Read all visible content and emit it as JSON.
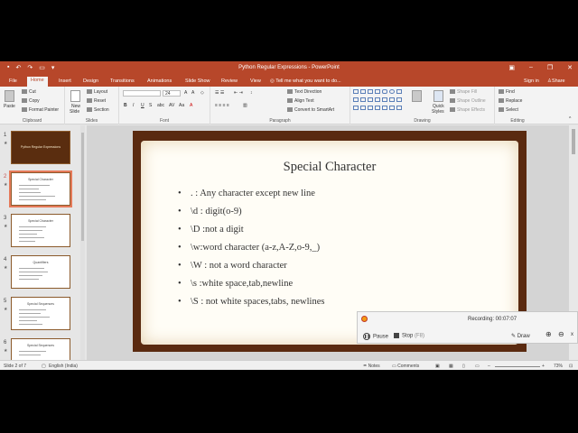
{
  "window": {
    "title": "Python Regular Expressions - PowerPoint"
  },
  "tabs": [
    {
      "label": "File"
    },
    {
      "label": "Home"
    },
    {
      "label": "Insert"
    },
    {
      "label": "Design"
    },
    {
      "label": "Transitions"
    },
    {
      "label": "Animations"
    },
    {
      "label": "Slide Show"
    },
    {
      "label": "Review"
    },
    {
      "label": "View"
    }
  ],
  "tell_me": "Tell me what you want to do...",
  "sign_in": "Sign in",
  "share": "Share",
  "ribbon": {
    "clipboard": {
      "label": "Clipboard",
      "paste": "Paste",
      "cut": "Cut",
      "copy": "Copy",
      "format_painter": "Format Painter"
    },
    "slides": {
      "label": "Slides",
      "new_slide": "New",
      "new_slide_2": "Slide",
      "layout": "Layout",
      "reset": "Reset",
      "section": "Section"
    },
    "font": {
      "label": "Font",
      "size": "24"
    },
    "paragraph": {
      "label": "Paragraph",
      "text_direction": "Text Direction",
      "align_text": "Align Text",
      "convert": "Convert to SmartArt"
    },
    "drawing": {
      "label": "Drawing",
      "arrange": "Arrange",
      "quick_styles": "Quick",
      "quick_styles_2": "Styles",
      "shape_fill": "Shape Fill",
      "shape_outline": "Shape Outline",
      "shape_effects": "Shape Effects"
    },
    "editing": {
      "label": "Editing",
      "find": "Find",
      "replace": "Replace",
      "select": "Select"
    }
  },
  "thumbnails": [
    {
      "num": "1",
      "title": "Python Regular Expressions"
    },
    {
      "num": "2",
      "title": "Special Character"
    },
    {
      "num": "3",
      "title": "Special Character"
    },
    {
      "num": "4",
      "title": "Quantifiers"
    },
    {
      "num": "5",
      "title": "Special Sequences"
    },
    {
      "num": "6",
      "title": "Special Sequences"
    }
  ],
  "slide": {
    "title": "Special Character",
    "bullets": [
      ". : Any character except new line",
      "\\d : digit(o-9)",
      "\\D :not a digit",
      "\\w:word character (a-z,A-Z,o-9,_)",
      "\\W : not a word character",
      "\\s :white space,tab,newline",
      "\\S : not white spaces,tabs, newlines"
    ]
  },
  "status": {
    "slide_of": "Slide 2 of 7",
    "language": "English (India)",
    "notes": "Notes",
    "comments": "Comments",
    "zoom": "73%"
  },
  "recorder": {
    "status": "Recording:  00:07:07",
    "pause": "Pause",
    "stop": "Stop",
    "stop_key": "(F8)",
    "draw": "Draw",
    "close": "x"
  }
}
